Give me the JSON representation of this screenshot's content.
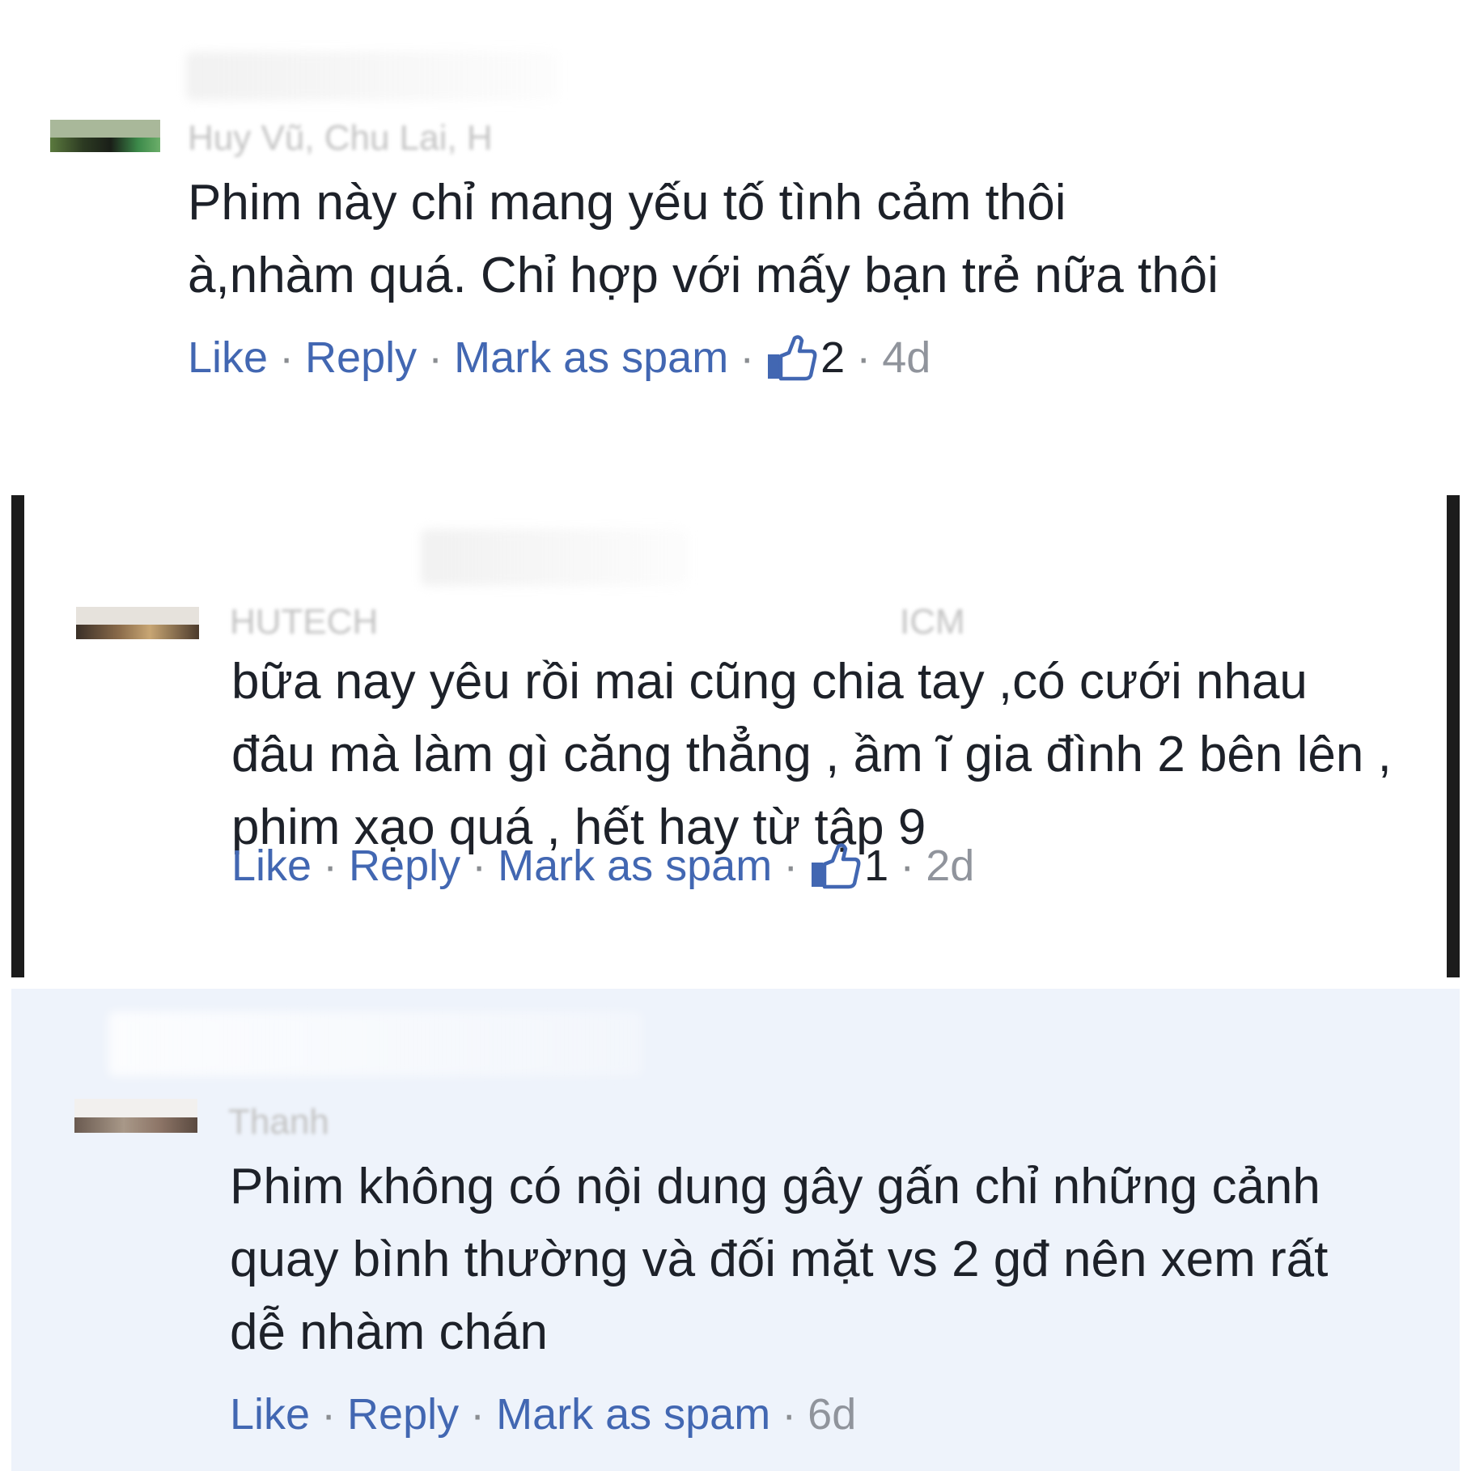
{
  "comments": [
    {
      "author": "Huy Vũ, Chu Lai, H",
      "text": "Phim này chỉ mang yếu tố tình cảm thôi à,nhàm quá. Chỉ hợp với mấy bạn trẻ nữa thôi",
      "actions": {
        "like": "Like",
        "reply": "Reply",
        "spam": "Mark as spam",
        "sep": "·",
        "like_count": "2",
        "time": "4d"
      }
    },
    {
      "author": "HUTECH",
      "author_suffix": "ICM",
      "text": "bữa nay yêu rồi mai cũng chia tay ,có cưới nhau đâu mà làm gì căng thẳng , ầm ĩ gia đình 2 bên lên , phim xạo quá , hết hay từ tập 9",
      "actions": {
        "like": "Like",
        "reply": "Reply",
        "spam": "Mark as spam",
        "sep": "·",
        "like_count": "1",
        "time": "2d"
      }
    },
    {
      "author": "Thanh",
      "text": "Phim không có nội dung gây gấn chỉ những cảnh quay bình thường và đối mặt vs 2 gđ nên xem rất dễ nhàm chán",
      "actions": {
        "like": "Like",
        "reply": "Reply",
        "spam": "Mark as spam",
        "sep": "·",
        "time": "6d"
      }
    }
  ],
  "colors": {
    "link": "#4267b2",
    "text": "#1d2129",
    "meta": "#90949c",
    "highlight_bg": "#eef3fb",
    "bar": "#1c1c1c"
  },
  "icons": {
    "like": "thumbs-up-icon"
  }
}
